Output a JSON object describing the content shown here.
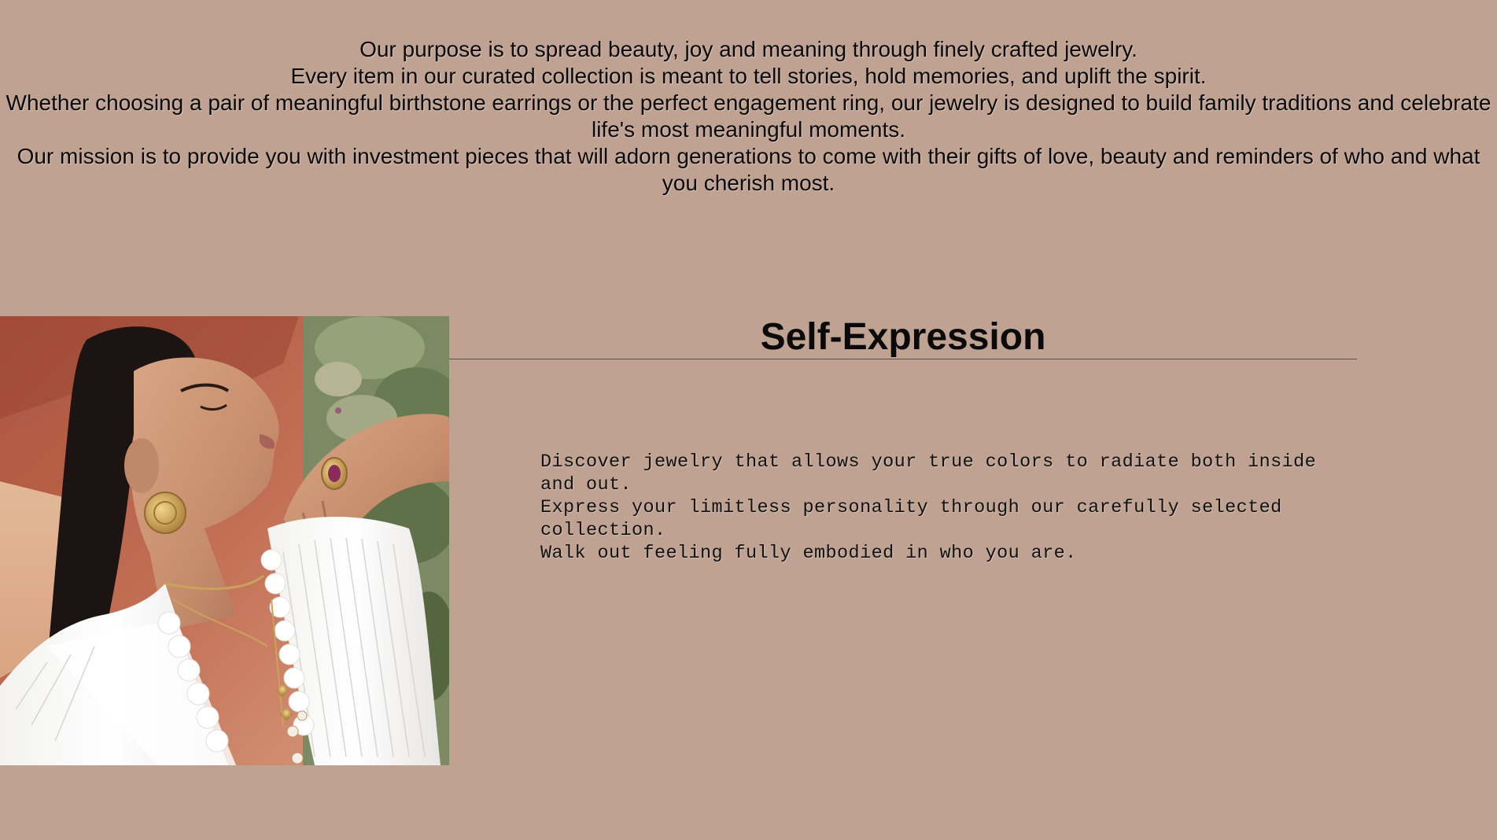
{
  "purpose": {
    "lines": [
      "Our purpose is to spread beauty, joy and meaning through finely crafted jewelry.",
      "Every item in our curated collection is meant to tell stories, hold memories, and uplift the spirit.",
      "Whether choosing a pair of meaningful birthstone earrings or the perfect engagement ring, our jewelry is designed to build family traditions and celebrate life's most meaningful moments.",
      "Our mission is to provide you with investment pieces that will adorn generations to come with their gifts of love, beauty and reminders of who and what you cherish most."
    ]
  },
  "feature": {
    "image_alt": "woman-wearing-gold-jewelry-photo",
    "title": "Self-Expression",
    "lines": [
      "Discover jewelry that allows your true colors to radiate both inside and out.",
      "Express your limitless personality through our carefully selected collection.",
      "Walk out feeling fully embodied in who you are."
    ]
  },
  "colors": {
    "background": "#c0a292",
    "text": "#0a0a0a",
    "divider": "#555555"
  }
}
